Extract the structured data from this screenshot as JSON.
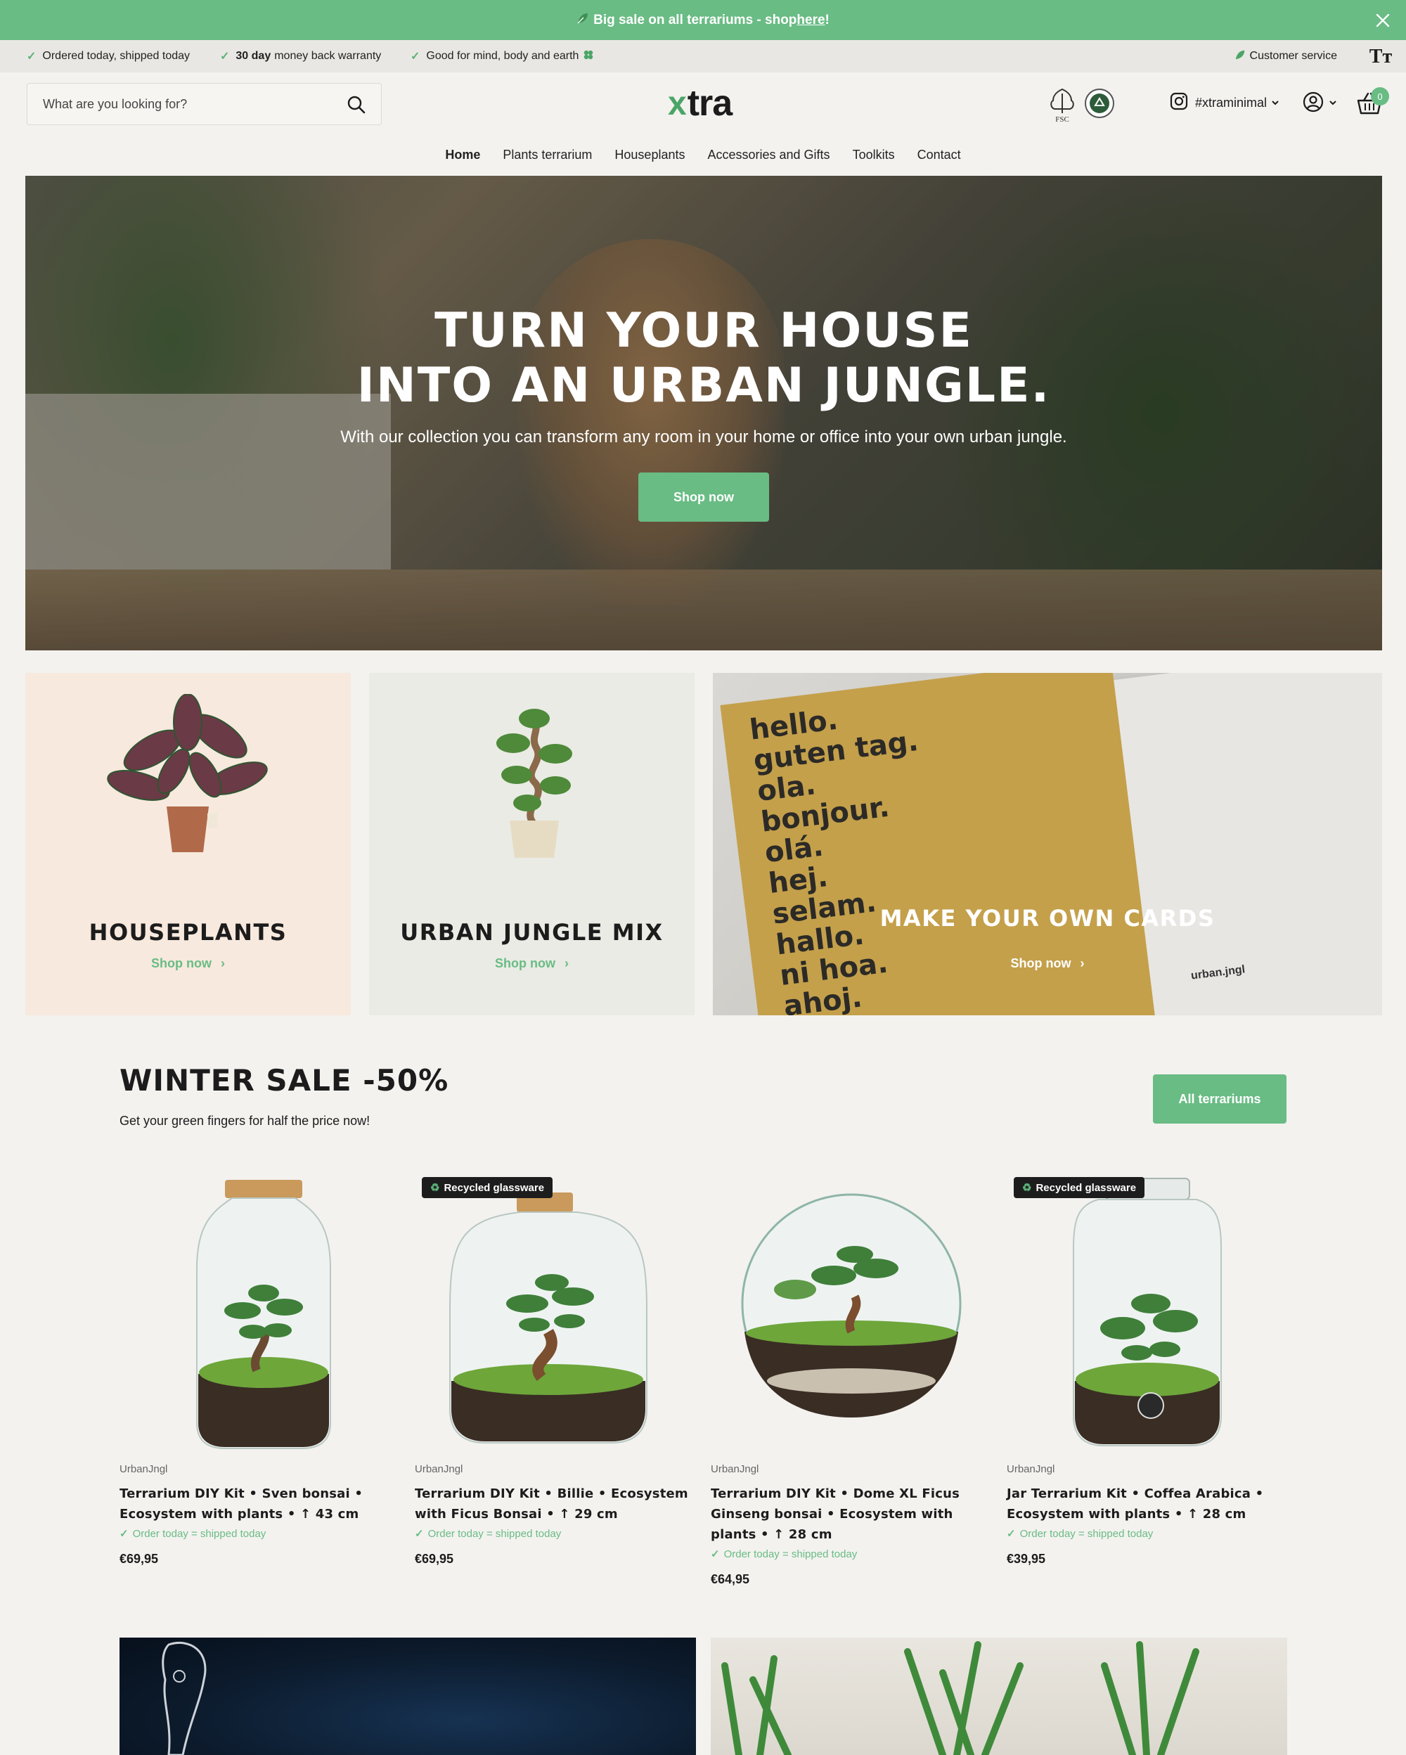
{
  "promo": {
    "text_before": "Big sale on all terrariums - shop ",
    "link": "here",
    "text_after": "!"
  },
  "usps": {
    "item1": "Ordered today, shipped today",
    "item2_bold": "30 day",
    "item2_rest": "money back warranty",
    "item3": "Good for mind, body and earth",
    "customer_service": "Customer service",
    "text_size_icon": "Tт"
  },
  "header": {
    "search_placeholder": "What are you looking for?",
    "logo_mark": "x",
    "logo_text": "tra",
    "badge_fsc": "FSC",
    "instagram": "#xtraminimal",
    "cart_count": "0"
  },
  "nav": {
    "items": [
      "Home",
      "Plants terrarium",
      "Houseplants",
      "Accessories and Gifts",
      "Toolkits",
      "Contact"
    ]
  },
  "hero": {
    "title_line1": "TURN YOUR HOUSE",
    "title_line2": "INTO AN URBAN JUNGLE.",
    "subtitle": "With our collection you can transform any room in your home or office into your own urban jungle.",
    "cta": "Shop now"
  },
  "categories": [
    {
      "title": "HOUSEPLANTS",
      "link": "Shop now"
    },
    {
      "title": "URBAN JUNGLE MIX",
      "link": "Shop now"
    },
    {
      "title": "MAKE YOUR OWN CARDS",
      "link": "Shop now",
      "card_words": [
        "hello.",
        "guten tag.",
        "ola.",
        "bonjour.",
        "olá.",
        "hej.",
        "selam.",
        "hallo.",
        "ni hoa.",
        "ahoj."
      ],
      "card_brand": "urban.jngl"
    }
  ],
  "sale": {
    "title": "WINTER SALE -50%",
    "subtitle": "Get your green fingers for half the price now!",
    "button": "All terrariums"
  },
  "products": [
    {
      "brand": "UrbanJngl",
      "name": "Terrarium DIY Kit • Sven bonsai • Ecosystem with plants • ↑ 43 cm",
      "ship": "Order today = shipped today",
      "price": "€69,95",
      "tag": ""
    },
    {
      "brand": "UrbanJngl",
      "name": "Terrarium DIY Kit • Billie • Ecosystem with Ficus Bonsai • ↑ 29 cm",
      "ship": "Order today = shipped today",
      "price": "€69,95",
      "tag": "Recycled glassware"
    },
    {
      "brand": "UrbanJngl",
      "name": "Terrarium DIY Kit • Dome XL Ficus Ginseng bonsai • Ecosystem with plants • ↑ 28 cm",
      "ship": "Order today = shipped today",
      "price": "€64,95",
      "tag": ""
    },
    {
      "brand": "UrbanJngl",
      "name": "Jar Terrarium Kit • Coffea Arabica • Ecosystem with plants • ↑ 28 cm",
      "ship": "Order today = shipped today",
      "price": "€39,95",
      "tag": "Recycled glassware"
    }
  ],
  "colors": {
    "accent": "#69bc84",
    "background": "#f3f2ef",
    "usp_bar": "#e9e7e3",
    "tag_bg": "#1d1d1d"
  },
  "icons": {
    "close": "close-icon",
    "check": "check-icon",
    "leaf": "leaf-icon",
    "search": "search-icon",
    "instagram": "instagram-icon",
    "user": "user-icon",
    "cart": "basket-icon",
    "chevron": "chevron-right-icon"
  }
}
